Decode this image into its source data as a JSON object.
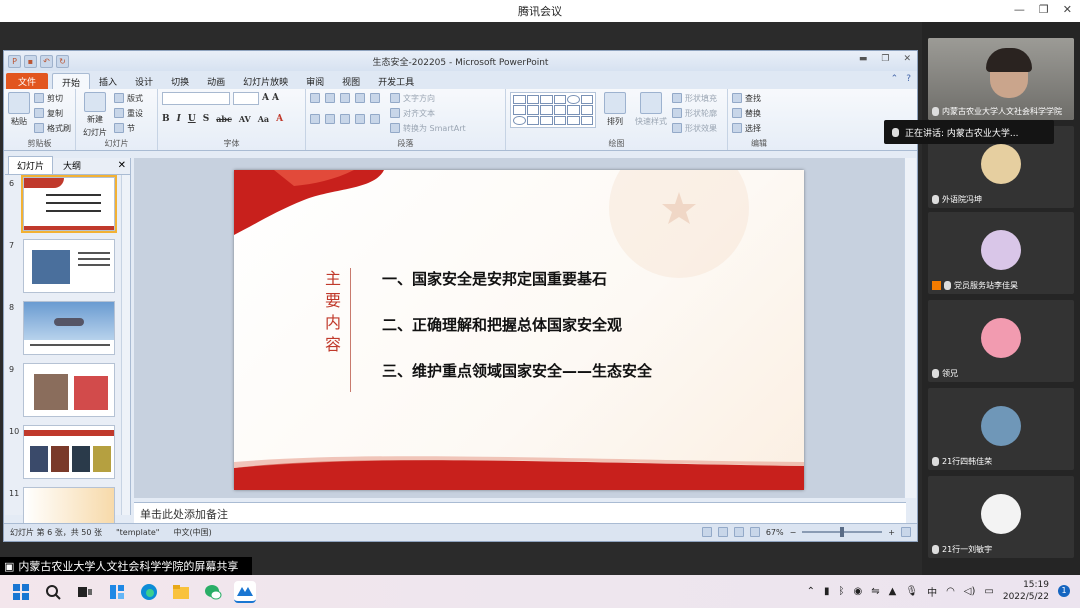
{
  "meeting": {
    "window_title": "腾讯会议",
    "controls": [
      "—",
      "❐",
      "✕"
    ]
  },
  "ppt": {
    "title": "生态安全-202205 - Microsoft PowerPoint",
    "tabs": [
      "文件",
      "开始",
      "插入",
      "设计",
      "切换",
      "动画",
      "幻灯片放映",
      "审阅",
      "视图",
      "开发工具"
    ],
    "active_tab": "开始",
    "ribbon": {
      "clipboard": {
        "paste": "粘贴",
        "cut": "剪切",
        "copy": "复制",
        "format_painter": "格式刷",
        "label": "剪贴板"
      },
      "slides": {
        "new_slide": "新建",
        "new_slide2": "幻灯片",
        "layout": "版式",
        "reset": "重设",
        "section": "节",
        "label": "幻灯片"
      },
      "font": {
        "label": "字体"
      },
      "paragraph": {
        "text_direction": "文字方向",
        "align_text": "对齐文本",
        "smartart": "转换为 SmartArt",
        "label": "段落"
      },
      "drawing": {
        "arrange": "排列",
        "quick_styles": "快速样式",
        "shape_fill": "形状填充",
        "shape_outline": "形状轮廓",
        "shape_effects": "形状效果",
        "label": "绘图"
      },
      "editing": {
        "find": "查找",
        "replace": "替换",
        "select": "选择",
        "label": "编辑"
      }
    },
    "left_pane": {
      "tabs": [
        "幻灯片",
        "大纲"
      ],
      "thumbnails": [
        {
          "num": "6"
        },
        {
          "num": "7"
        },
        {
          "num": "8"
        },
        {
          "num": "9"
        },
        {
          "num": "10"
        },
        {
          "num": "11"
        }
      ]
    },
    "slide": {
      "vertical_title": [
        "主",
        "要",
        "内",
        "容"
      ],
      "items": [
        "一、国家安全是安邦定国重要基石",
        "二、正确理解和把握总体国家安全观",
        "三、维护重点领域国家安全——生态安全"
      ]
    },
    "notes_placeholder": "单击此处添加备注",
    "status": {
      "slide_info": "幻灯片 第 6 张，共 50 张",
      "theme": "\"template\"",
      "language": "中文(中国)",
      "zoom": "67%"
    }
  },
  "participants": [
    {
      "name": "内蒙古农业大学人文社会科学学院",
      "avatar_color": "#c9b8a6"
    },
    {
      "name": "外语院冯坤",
      "avatar_color": "#e6cfa0"
    },
    {
      "name": "党员服务站李佳昊",
      "avatar_color": "#d9c6e8"
    },
    {
      "name": "领兄",
      "avatar_color": "#f29bb0"
    },
    {
      "name": "21行四韩佳荣",
      "avatar_color": "#6f97b8"
    },
    {
      "name": "21行一刘敏宇",
      "avatar_color": "#f3f3f3"
    }
  ],
  "speaking_tooltip": "正在讲话: 内蒙古农业大学...",
  "share_banner": "内蒙古农业大学人文社会科学学院的屏幕共享",
  "taskbar": {
    "ime": "中",
    "time": "15:19",
    "date": "2022/5/22",
    "notifications": "1"
  },
  "colors": {
    "accent_red": "#c0392b",
    "file_tab": "#e2561f"
  }
}
